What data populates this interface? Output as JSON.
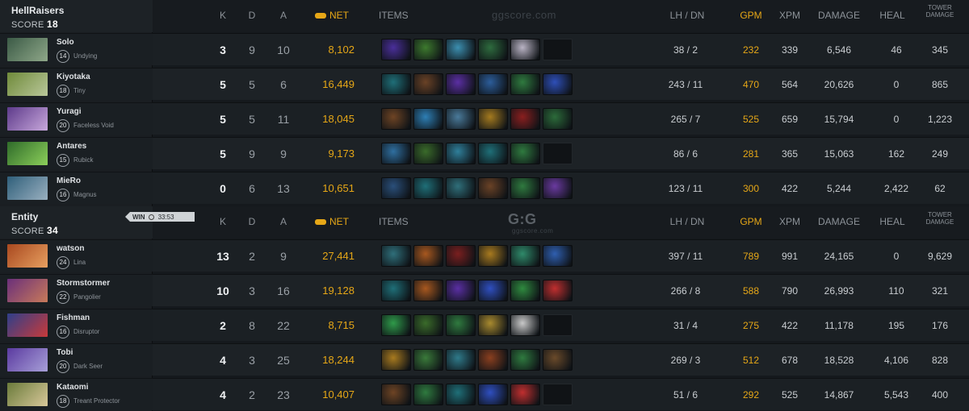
{
  "watermark_top": "ggscore.com",
  "watermark_logo": "G:G",
  "watermark_bottom": "ggscore.com",
  "headers": {
    "k": "K",
    "d": "D",
    "a": "A",
    "net": "NET",
    "items": "ITEMS",
    "lhdn": "LH / DN",
    "gpm": "GPM",
    "xpm": "XPM",
    "damage": "DAMAGE",
    "heal": "HEAL",
    "tower_1": "TOWER",
    "tower_2": "DAMAGE"
  },
  "win_badge": {
    "label": "WIN",
    "time": "33:53"
  },
  "teams": [
    {
      "name": "HellRaisers",
      "score_label": "SCORE",
      "score": "18",
      "players": [
        {
          "name": "Solo",
          "level": "14",
          "hero": "Undying",
          "k": "3",
          "d": "9",
          "a": "10",
          "net": "8,102",
          "lhdn": "38 / 2",
          "gpm": "232",
          "xpm": "339",
          "damage": "6,546",
          "heal": "46",
          "tower": "345",
          "portrait": [
            "#3b5a46",
            "#8fa889"
          ],
          "items": [
            "#4a2f9a",
            "#3d7a2e",
            "#3c8fb0",
            "#2e6b3e",
            "#b9b3c4",
            null
          ]
        },
        {
          "name": "Kiyotaka",
          "level": "18",
          "hero": "Tiny",
          "k": "5",
          "d": "5",
          "a": "6",
          "net": "16,449",
          "lhdn": "243 / 11",
          "gpm": "470",
          "xpm": "564",
          "damage": "20,626",
          "heal": "0",
          "tower": "865",
          "portrait": [
            "#6f8a3a",
            "#b9c79a"
          ],
          "items": [
            "#1f6f78",
            "#6a4226",
            "#5b2fa3",
            "#2c5d9a",
            "#2f7a3f",
            "#2e4fb8"
          ]
        },
        {
          "name": "Yuragi",
          "level": "20",
          "hero": "Faceless Void",
          "k": "5",
          "d": "5",
          "a": "11",
          "net": "18,045",
          "lhdn": "265 / 7",
          "gpm": "525",
          "xpm": "659",
          "damage": "15,794",
          "heal": "0",
          "tower": "1,223",
          "portrait": [
            "#5d3a8a",
            "#c8a8dc"
          ],
          "items": [
            "#6e4424",
            "#2e7fb5",
            "#4a7a9a",
            "#a47a1f",
            "#8a1f1f",
            "#2c6b3a"
          ]
        },
        {
          "name": "Antares",
          "level": "15",
          "hero": "Rubick",
          "k": "5",
          "d": "9",
          "a": "9",
          "net": "9,173",
          "lhdn": "86 / 6",
          "gpm": "281",
          "xpm": "365",
          "damage": "15,063",
          "heal": "162",
          "tower": "249",
          "portrait": [
            "#2f6b2a",
            "#8ccf5a"
          ],
          "items": [
            "#2f6fa0",
            "#3a6b2a",
            "#2f7f9a",
            "#1f6f78",
            "#2f7a3f",
            null
          ]
        },
        {
          "name": "MieRo",
          "level": "16",
          "hero": "Magnus",
          "k": "0",
          "d": "6",
          "a": "13",
          "net": "10,651",
          "lhdn": "123 / 11",
          "gpm": "300",
          "xpm": "422",
          "damage": "5,244",
          "heal": "2,422",
          "tower": "62",
          "portrait": [
            "#2f5f7a",
            "#9ab0c0"
          ],
          "items": [
            "#2a4f7a",
            "#1f6f78",
            "#2f6f7a",
            "#6a4226",
            "#2f7a3f",
            "#6a3aa0"
          ]
        }
      ]
    },
    {
      "name": "Entity",
      "score_label": "SCORE",
      "score": "34",
      "players": [
        {
          "name": "watson",
          "level": "24",
          "hero": "Lina",
          "k": "13",
          "d": "2",
          "a": "9",
          "net": "27,441",
          "lhdn": "397 / 11",
          "gpm": "789",
          "xpm": "991",
          "damage": "24,165",
          "heal": "0",
          "tower": "9,629",
          "portrait": [
            "#a8481f",
            "#e8a060"
          ],
          "items": [
            "#2f6f7a",
            "#a8581f",
            "#7a1f1f",
            "#a87a1f",
            "#2f8a6a",
            "#2f5fb0"
          ]
        },
        {
          "name": "Stormstormer",
          "level": "22",
          "hero": "Pangolier",
          "k": "10",
          "d": "3",
          "a": "16",
          "net": "19,128",
          "lhdn": "266 / 8",
          "gpm": "588",
          "xpm": "790",
          "damage": "26,993",
          "heal": "110",
          "tower": "321",
          "portrait": [
            "#6a2f7a",
            "#c87a5a"
          ],
          "items": [
            "#1f6f78",
            "#a8581f",
            "#5a2fa3",
            "#2f4fc0",
            "#2f8a3f",
            "#c02f2f"
          ]
        },
        {
          "name": "Fishman",
          "level": "16",
          "hero": "Disruptor",
          "k": "2",
          "d": "8",
          "a": "22",
          "net": "8,715",
          "lhdn": "31 / 4",
          "gpm": "275",
          "xpm": "422",
          "damage": "11,178",
          "heal": "195",
          "tower": "176",
          "portrait": [
            "#2f3f8a",
            "#c83a3a"
          ],
          "items": [
            "#2f9a4a",
            "#3a6b2a",
            "#2f7a3f",
            "#a88a2f",
            "#c8c8c8",
            null
          ]
        },
        {
          "name": "Tobi",
          "level": "20",
          "hero": "Dark Seer",
          "k": "4",
          "d": "3",
          "a": "25",
          "net": "18,244",
          "lhdn": "269 / 3",
          "gpm": "512",
          "xpm": "678",
          "damage": "18,528",
          "heal": "4,106",
          "tower": "828",
          "portrait": [
            "#5a3aa0",
            "#a8a0d8"
          ],
          "items": [
            "#a87a1f",
            "#3a7a3a",
            "#2f7a8a",
            "#8a3f1f",
            "#2f7a3f",
            "#6a4a2a"
          ]
        },
        {
          "name": "Kataomi",
          "level": "18",
          "hero": "Treant Protector",
          "k": "4",
          "d": "2",
          "a": "23",
          "net": "10,407",
          "lhdn": "51 / 6",
          "gpm": "292",
          "xpm": "525",
          "damage": "14,867",
          "heal": "5,543",
          "tower": "400",
          "portrait": [
            "#6a7a3a",
            "#d8c89a"
          ],
          "items": [
            "#6e4424",
            "#2f7a3f",
            "#1f6f78",
            "#2f4fc0",
            "#c02f2f",
            null
          ]
        }
      ]
    }
  ]
}
